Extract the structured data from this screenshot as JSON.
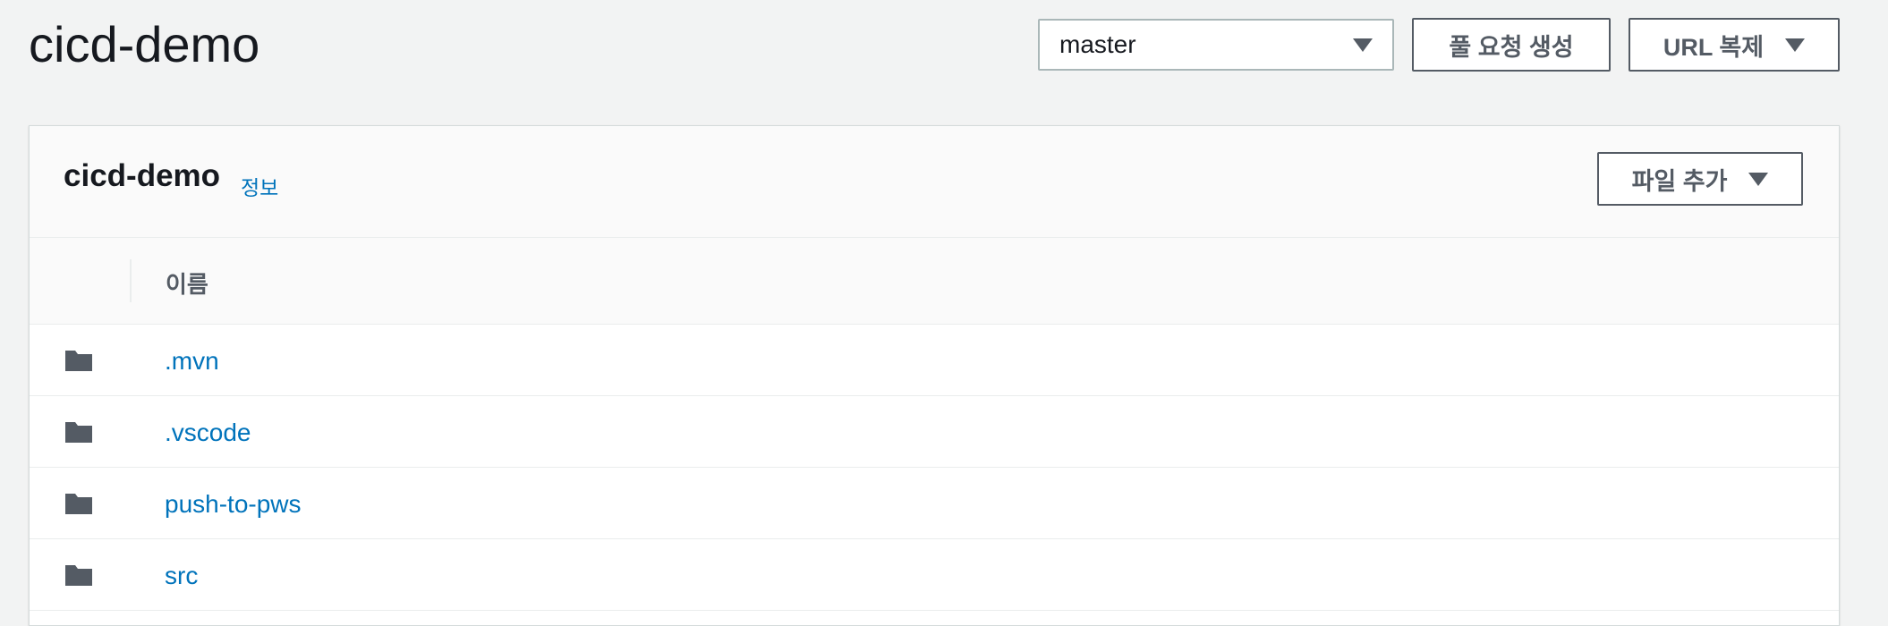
{
  "page": {
    "title": "cicd-demo"
  },
  "toolbar": {
    "branch_select_value": "master",
    "create_pr_label": "풀 요청 생성",
    "clone_url_label": "URL 복제"
  },
  "panel": {
    "title": "cicd-demo",
    "info_link": "정보",
    "add_file_label": "파일 추가"
  },
  "table": {
    "columns": [
      "이름"
    ],
    "rows": [
      {
        "name": ".mvn",
        "icon": "folder-icon"
      },
      {
        "name": ".vscode",
        "icon": "folder-icon"
      },
      {
        "name": "push-to-pws",
        "icon": "folder-icon"
      },
      {
        "name": "src",
        "icon": "folder-icon"
      }
    ]
  },
  "colors": {
    "link": "#0073bb",
    "text_dark": "#16191f",
    "text_secondary": "#545b64",
    "background": "#f2f3f3"
  }
}
